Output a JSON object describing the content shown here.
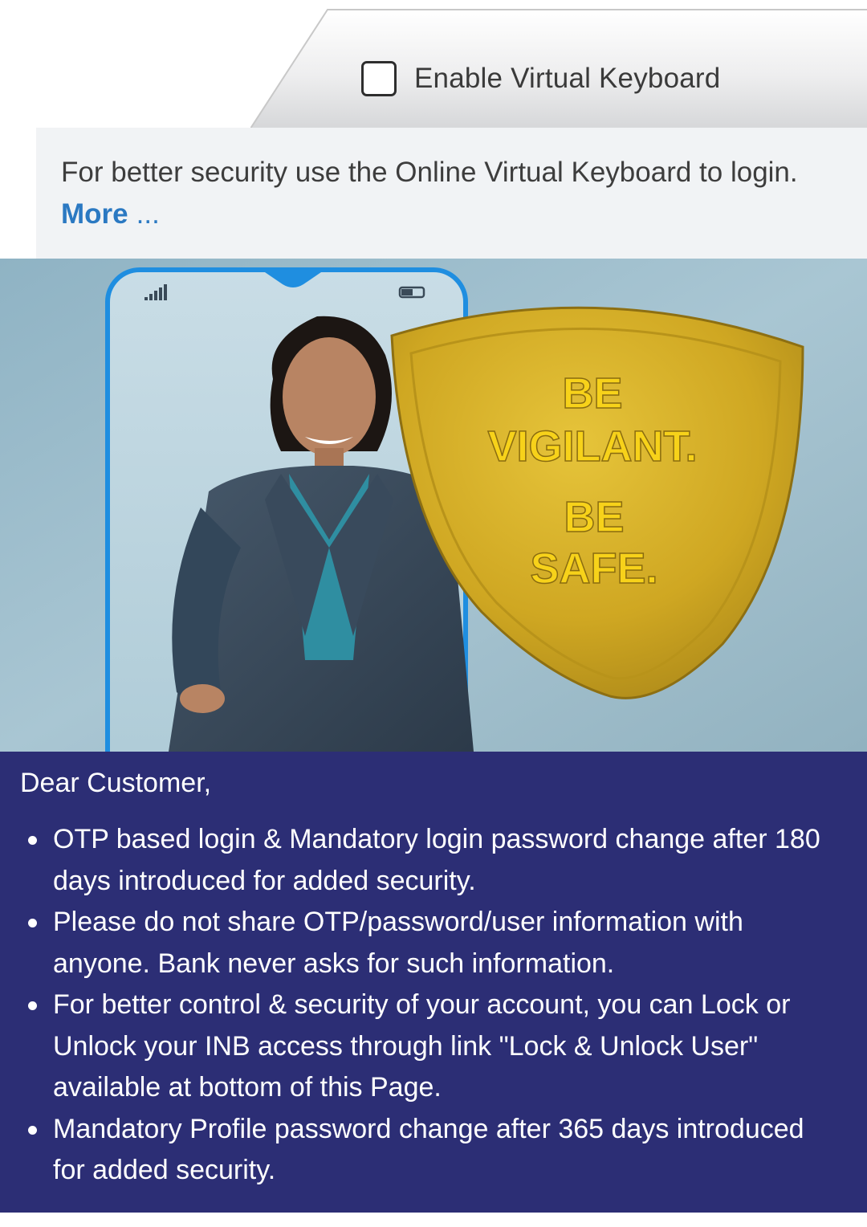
{
  "virtual_keyboard": {
    "label": "Enable Virtual Keyboard",
    "checked": false
  },
  "security_note": {
    "text": "For better security use the Online Virtual Keyboard to login.",
    "more_label": "More",
    "more_ellipsis": "..."
  },
  "banner": {
    "shield_lines": [
      "BE",
      "VIGILANT.",
      "BE",
      "SAFE."
    ]
  },
  "notice": {
    "greeting": "Dear Customer,",
    "items": [
      "OTP based login & Mandatory login password change after 180 days introduced for added security.",
      "Please do not share OTP/password/user information with anyone. Bank never asks for such information.",
      "For better control & security of your account, you can Lock or Unlock your INB access through link \"Lock & Unlock User\" available at bottom of this Page.",
      "Mandatory Profile password change after 365 days introduced for added security."
    ]
  },
  "colors": {
    "notice_bg": "#2c2e75",
    "link": "#2b79c2",
    "shield": "#d9b323",
    "shield_text": "#f7d21a"
  }
}
